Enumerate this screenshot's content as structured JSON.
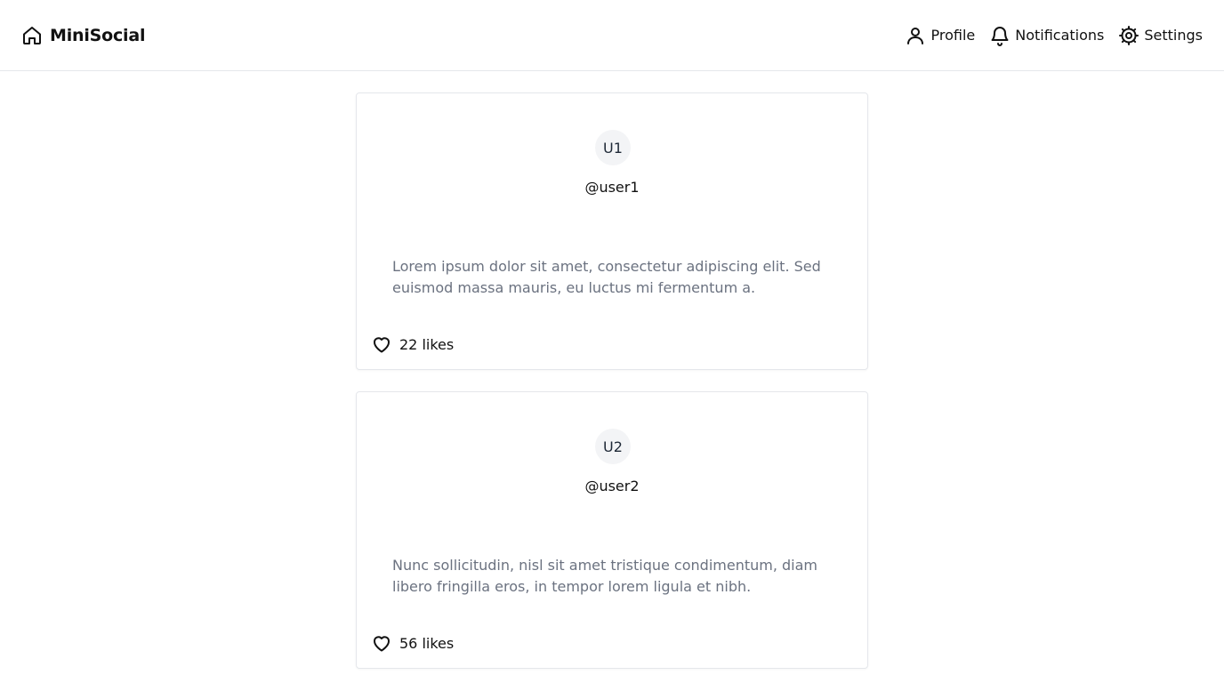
{
  "app": {
    "brand": "MiniSocial",
    "brand_icon": "home-icon"
  },
  "nav": {
    "profile": "Profile",
    "notifications": "Notifications",
    "settings": "Settings"
  },
  "posts": [
    {
      "avatar": "U1",
      "username": "@user1",
      "text": "Lorem ipsum dolor sit amet, consectetur adipiscing elit. Sed euismod massa mauris, eu luctus mi fermentum a.",
      "likes": "22 likes"
    },
    {
      "avatar": "U2",
      "username": "@user2",
      "text": "Nunc sollicitudin, nisl sit amet tristique condimentum, diam libero fringilla eros, in tempor lorem ligula et nibh.",
      "likes": "56 likes"
    }
  ],
  "colors": {
    "text": "#111111",
    "muted_text": "#6b7280",
    "border": "#e5e7eb",
    "avatar_bg": "#f3f4f6"
  }
}
